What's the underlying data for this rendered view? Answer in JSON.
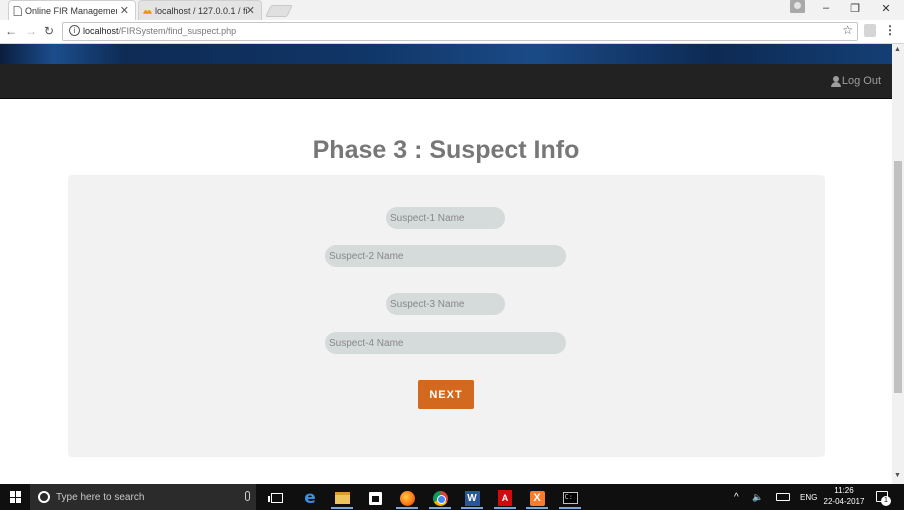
{
  "browser": {
    "tabs": [
      {
        "label": "Online FIR Management",
        "close": "✕"
      },
      {
        "label": "localhost / 127.0.0.1 / fir",
        "close": "✕"
      }
    ],
    "window_controls": {
      "minimize": "–",
      "restore": "❐",
      "close": "✕"
    },
    "nav": {
      "back": "←",
      "forward": "→",
      "reload": "↻"
    },
    "address": {
      "host": "localhost",
      "path": "/FIRSystem/find_suspect.php",
      "info": "i",
      "star": "☆"
    },
    "menu": "⋮"
  },
  "site": {
    "navbar": {
      "logout_label": "Log Out"
    },
    "page_title": "Phase 3 : Suspect Info",
    "form": {
      "suspect1_placeholder": "Suspect-1 Name",
      "suspect2_placeholder": "Suspect-2 Name",
      "suspect3_placeholder": "Suspect-3 Name",
      "suspect4_placeholder": "Suspect-4 Name",
      "next_label": "NEXT"
    },
    "accent_color": "#d2691e"
  },
  "scrollbar": {
    "up": "▲",
    "down": "▼"
  },
  "taskbar": {
    "search_placeholder": "Type here to search",
    "pinned": [
      "task-view",
      "edge",
      "file-explorer",
      "store",
      "firefox",
      "chrome",
      "word",
      "acrobat",
      "xampp",
      "command-prompt"
    ],
    "tray": {
      "chevron": "^",
      "volume": "🔈",
      "language": "ENG",
      "time": "11:26",
      "date": "22-04-2017",
      "notification_count": "1"
    }
  }
}
